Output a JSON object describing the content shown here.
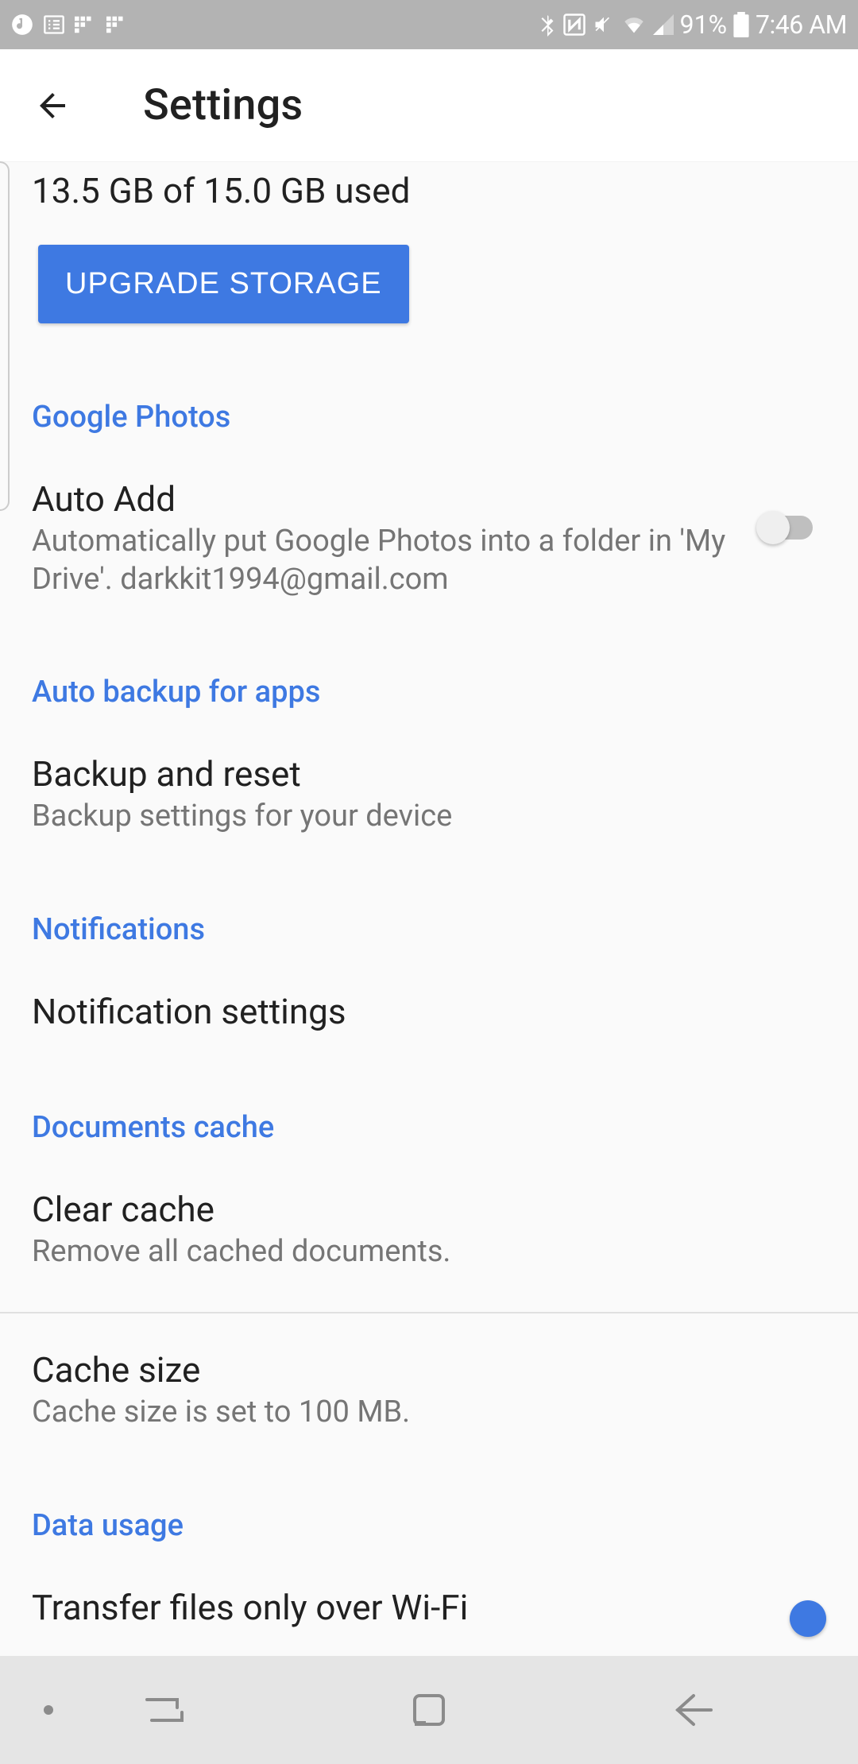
{
  "statusBar": {
    "batteryPct": "91%",
    "time": "7:46 AM"
  },
  "appBar": {
    "title": "Settings"
  },
  "storage": {
    "usage": "13.5 GB of 15.0 GB used",
    "upgradeLabel": "UPGRADE STORAGE"
  },
  "sections": {
    "googlePhotos": {
      "header": "Google Photos",
      "autoAdd": {
        "title": "Auto Add",
        "subtitle": "Automatically put Google Photos into a folder in 'My Drive'. darkkit1994@gmail.com"
      }
    },
    "autoBackup": {
      "header": "Auto backup for apps",
      "backupReset": {
        "title": "Backup and reset",
        "subtitle": "Backup settings for your device"
      }
    },
    "notifications": {
      "header": "Notifications",
      "settings": {
        "title": "Notification settings"
      }
    },
    "documentsCache": {
      "header": "Documents cache",
      "clearCache": {
        "title": "Clear cache",
        "subtitle": "Remove all cached documents."
      },
      "cacheSize": {
        "title": "Cache size",
        "subtitle": "Cache size is set to 100 MB."
      }
    },
    "dataUsage": {
      "header": "Data usage",
      "wifiOnly": {
        "title": "Transfer files only over Wi-Fi"
      }
    }
  }
}
